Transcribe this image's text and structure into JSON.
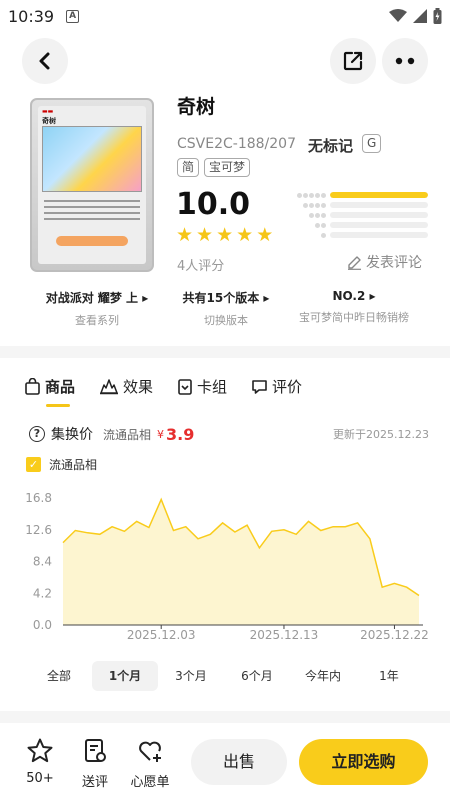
{
  "status_bar": {
    "time": "10:39",
    "a_badge": "A"
  },
  "card": {
    "name": "奇树",
    "code": "CSVE2C-188/207",
    "mark": "无标记",
    "grade_badge": "G",
    "tags": [
      "简",
      "宝可梦"
    ],
    "score": "10.0",
    "stars": 5,
    "ratings_count": "4人评分",
    "comment_label": "发表评论",
    "rating_distribution": [
      1.0,
      0,
      0,
      0,
      0
    ],
    "card_face_name": "奇树"
  },
  "info": [
    {
      "main": "对战派对  耀梦  上",
      "sub": "查看系列"
    },
    {
      "main": "共有15个版本",
      "sub": "切换版本"
    },
    {
      "main": "NO.2",
      "sub": "宝可梦简中昨日畅销榜"
    }
  ],
  "tabs": [
    {
      "label": "商品",
      "icon": "shopping-bag-icon",
      "active": true
    },
    {
      "label": "效果",
      "icon": "burst-icon",
      "active": false
    },
    {
      "label": "卡组",
      "icon": "deck-icon",
      "active": false
    },
    {
      "label": "评价",
      "icon": "comment-icon",
      "active": false
    }
  ],
  "price": {
    "label": "集换价",
    "condition": "流通品相",
    "currency": "¥",
    "value": "3.9",
    "updated": "更新于2025.12.23"
  },
  "legend": {
    "label": "流通品相",
    "checked": true
  },
  "chart_data": {
    "type": "area",
    "series": [
      {
        "values": [
          10.9,
          12.5,
          12.2,
          12.0,
          13.0,
          12.4,
          13.7,
          12.9,
          16.6,
          12.5,
          13.0,
          11.4,
          12.0,
          13.5,
          12.3,
          13.2,
          10.2,
          12.4,
          12.6,
          12.0,
          13.7,
          12.5,
          13.0,
          13.0,
          13.5,
          11.4,
          5.0,
          5.5,
          5.0,
          3.9
        ]
      }
    ],
    "x_ticks": [
      "2025.12.03",
      "2025.12.13",
      "2025.12.22"
    ],
    "y_ticks": [
      "16.8",
      "12.6",
      "8.4",
      "4.2",
      "0.0"
    ],
    "ylim": [
      0,
      16.8
    ],
    "grid": false,
    "color": "#f9cc1b"
  },
  "ranges": [
    {
      "label": "全部",
      "active": false
    },
    {
      "label": "1个月",
      "active": true
    },
    {
      "label": "3个月",
      "active": false
    },
    {
      "label": "6个月",
      "active": false
    },
    {
      "label": "今年内",
      "active": false
    },
    {
      "label": "1年",
      "active": false
    }
  ],
  "bottom": {
    "fav_count": "50+",
    "review_label": "送评",
    "wishlist_label": "心愿单",
    "sell_label": "出售",
    "buy_label": "立即选购"
  },
  "colors": {
    "accent": "#f9cc1b",
    "price": "#e62e2e"
  }
}
